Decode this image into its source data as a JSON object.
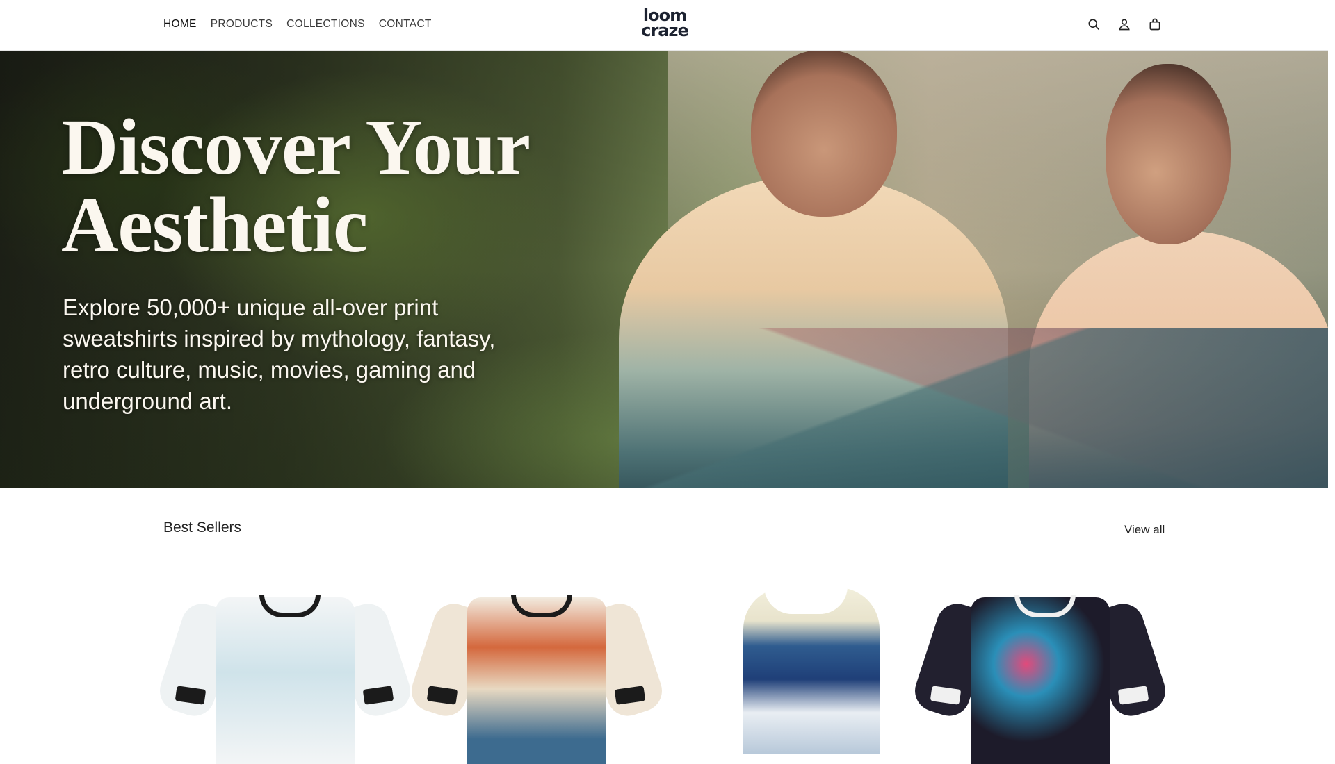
{
  "header": {
    "nav": [
      "HOME",
      "PRODUCTS",
      "COLLECTIONS",
      "CONTACT"
    ],
    "logo_line1": "loom",
    "logo_line2": "craze",
    "icons": [
      "search-icon",
      "account-icon",
      "cart-icon"
    ]
  },
  "hero": {
    "title_line1": "Discover Your",
    "title_line2": "Aesthetic",
    "subtitle": "Explore 50,000+ unique all-over print sweatshirts inspired by mythology, fantasy, retro culture, music, movies, gaming and underground art."
  },
  "best_sellers": {
    "title": "Best Sellers",
    "view_all": "View all",
    "products": [
      {
        "description": "kitten print sweatshirt",
        "color": "#f3f5f6",
        "accent": "#bcd9e3"
      },
      {
        "description": "ramen wave print sweatshirt",
        "color": "#f2ebdf",
        "accent": "#c4532c"
      },
      {
        "description": "great wave print tank top",
        "color": "#f1eedb",
        "accent": "#1f3f78"
      },
      {
        "description": "octopus skull print sweatshirt",
        "color": "#1d1b2a",
        "accent": "#e24a7b"
      }
    ]
  },
  "colors": {
    "header_bg": "#ffffff",
    "text": "#222222",
    "hero_text": "#fbf7ef"
  }
}
